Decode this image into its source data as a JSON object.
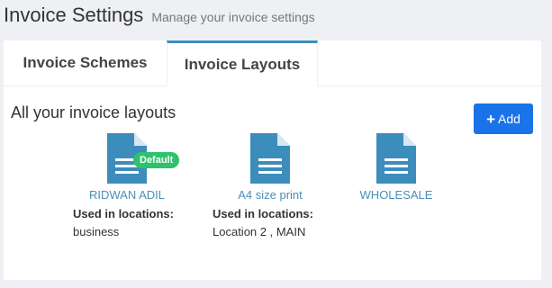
{
  "header": {
    "title": "Invoice Settings",
    "subtitle": "Manage your invoice settings"
  },
  "tabs": [
    {
      "label": "Invoice Schemes",
      "active": false
    },
    {
      "label": "Invoice Layouts",
      "active": true
    }
  ],
  "section": {
    "title": "All your invoice layouts",
    "add_label": "Add"
  },
  "colors": {
    "accent": "#3c8dbc",
    "primary_button": "#1a73e8",
    "badge": "#2dc26b",
    "link": "#4a8fb8"
  },
  "layouts": [
    {
      "name": "RIDWAN ADIL",
      "icon": "file-text-icon",
      "badge": "Default",
      "locations_label": "Used in locations:",
      "locations": "business"
    },
    {
      "name": "A4 size print",
      "icon": "file-text-icon",
      "locations_label": "Used in locations:",
      "locations": "Location 2 ,  MAIN"
    },
    {
      "name": "WHOLESALE",
      "icon": "file-text-icon"
    }
  ]
}
